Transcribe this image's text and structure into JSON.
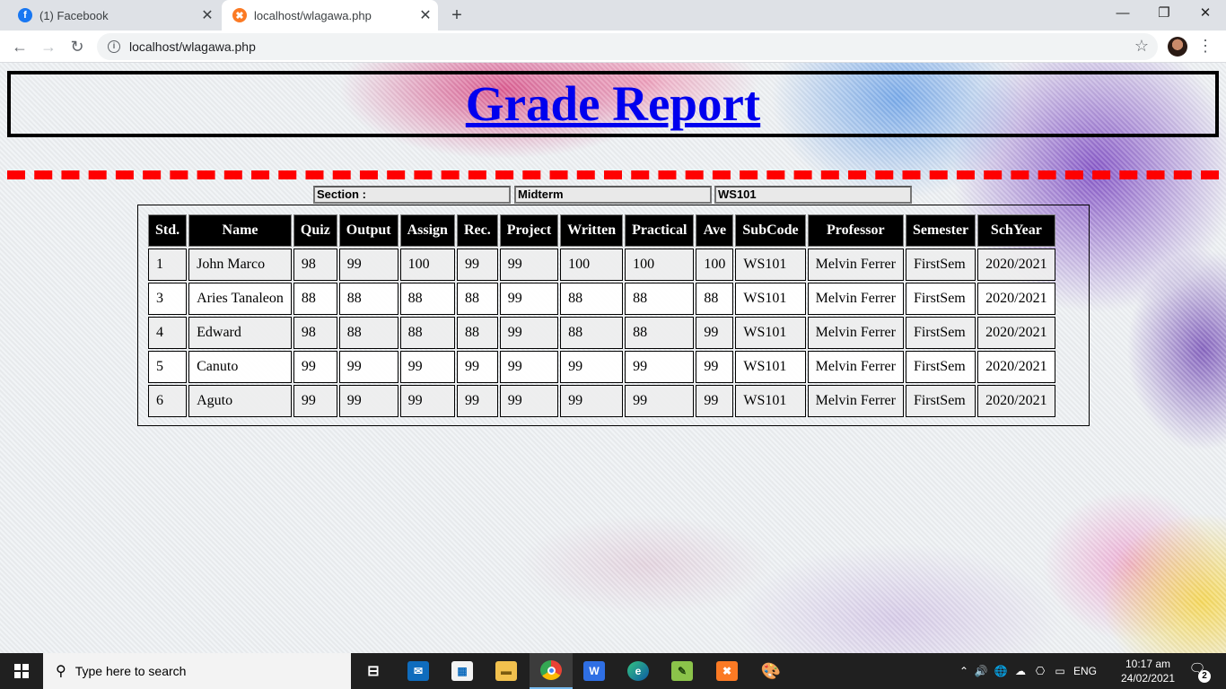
{
  "browser": {
    "tabs": [
      {
        "title": "(1) Facebook",
        "active": false,
        "icon": "facebook-icon"
      },
      {
        "title": "localhost/wlagawa.php",
        "active": true,
        "icon": "xampp-icon"
      }
    ],
    "url": "localhost/wlagawa.php"
  },
  "page": {
    "title": "Grade Report",
    "filters": {
      "section": "Section :",
      "term": "Midterm",
      "subject": "WS101"
    },
    "table": {
      "headers": [
        "Std.",
        "Name",
        "Quiz",
        "Output",
        "Assign",
        "Rec.",
        "Project",
        "Written",
        "Practical",
        "Ave",
        "SubCode",
        "Professor",
        "Semester",
        "SchYear"
      ],
      "rows": [
        [
          "1",
          "John Marco",
          "98",
          "99",
          "100",
          "99",
          "99",
          "100",
          "100",
          "100",
          "WS101",
          "Melvin Ferrer",
          "FirstSem",
          "2020/2021"
        ],
        [
          "3",
          "Aries Tanaleon",
          "88",
          "88",
          "88",
          "88",
          "99",
          "88",
          "88",
          "88",
          "WS101",
          "Melvin Ferrer",
          "FirstSem",
          "2020/2021"
        ],
        [
          "4",
          "Edward",
          "98",
          "88",
          "88",
          "88",
          "99",
          "88",
          "88",
          "99",
          "WS101",
          "Melvin Ferrer",
          "FirstSem",
          "2020/2021"
        ],
        [
          "5",
          "Canuto",
          "99",
          "99",
          "99",
          "99",
          "99",
          "99",
          "99",
          "99",
          "WS101",
          "Melvin Ferrer",
          "FirstSem",
          "2020/2021"
        ],
        [
          "6",
          "Aguto",
          "99",
          "99",
          "99",
          "99",
          "99",
          "99",
          "99",
          "99",
          "WS101",
          "Melvin Ferrer",
          "FirstSem",
          "2020/2021"
        ]
      ]
    }
  },
  "taskbar": {
    "search_placeholder": "Type here to search",
    "language": "ENG",
    "time": "10:17 am",
    "date": "24/02/2021",
    "notification_count": "2"
  },
  "colors": {
    "title_link": "#0000ee",
    "dash_line": "#ff0000",
    "header_bg": "#000000"
  }
}
